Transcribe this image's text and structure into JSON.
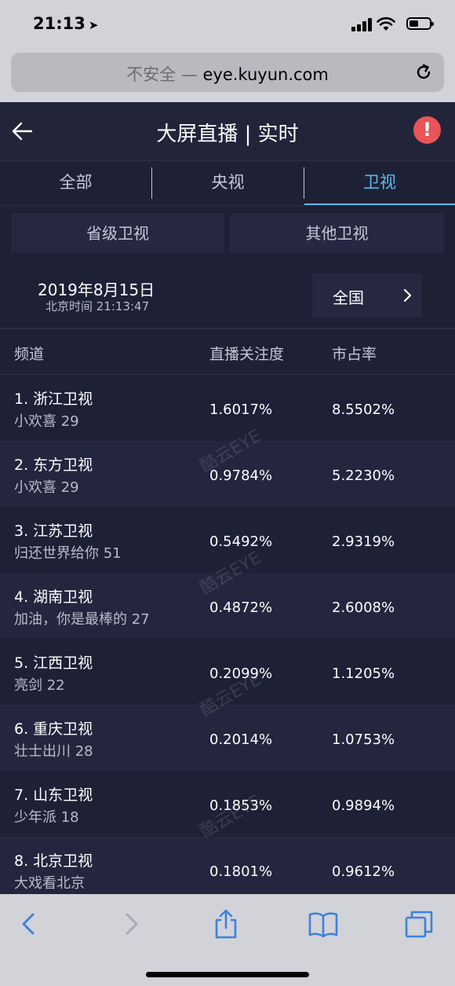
{
  "status_bar": {
    "time": "21:13",
    "location_glyph": "➤"
  },
  "browser": {
    "insecure_label": "不安全 — ",
    "domain": "eye.kuyun.com"
  },
  "header": {
    "title": "大屏直播 | 实时",
    "alert_glyph": "!"
  },
  "tabs": [
    {
      "label": "全部"
    },
    {
      "label": "央视"
    },
    {
      "label": "卫视"
    }
  ],
  "subtabs": [
    {
      "label": "省级卫视"
    },
    {
      "label": "其他卫视"
    }
  ],
  "date": {
    "date": "2019年8月15日",
    "clock": "北京时间 21:13:47"
  },
  "region": {
    "label": "全国"
  },
  "table": {
    "headers": {
      "channel": "频道",
      "attention": "直播关注度",
      "share": "市占率"
    },
    "rows": [
      {
        "channel": "1. 浙江卫视",
        "program": "小欢喜 29",
        "attention": "1.6017%",
        "share": "8.5502%"
      },
      {
        "channel": "2. 东方卫视",
        "program": "小欢喜 29",
        "attention": "0.9784%",
        "share": "5.2230%"
      },
      {
        "channel": "3. 江苏卫视",
        "program": "归还世界给你 51",
        "attention": "0.5492%",
        "share": "2.9319%"
      },
      {
        "channel": "4. 湖南卫视",
        "program": "加油，你是最棒的 27",
        "attention": "0.4872%",
        "share": "2.6008%"
      },
      {
        "channel": "5. 江西卫视",
        "program": "亮剑 22",
        "attention": "0.2099%",
        "share": "1.1205%"
      },
      {
        "channel": "6. 重庆卫视",
        "program": "壮士出川 28",
        "attention": "0.2014%",
        "share": "1.0753%"
      },
      {
        "channel": "7. 山东卫视",
        "program": "少年派 18",
        "attention": "0.1853%",
        "share": "0.9894%"
      },
      {
        "channel": "8. 北京卫视",
        "program": "大戏看北京",
        "attention": "0.1801%",
        "share": "0.9612%"
      }
    ]
  },
  "watermark": {
    "text": "酷云EYE"
  },
  "colors": {
    "accent": "#5fb9e8",
    "alert": "#e85457",
    "ios_blue": "#3b82e0",
    "background": "#1e2036"
  }
}
